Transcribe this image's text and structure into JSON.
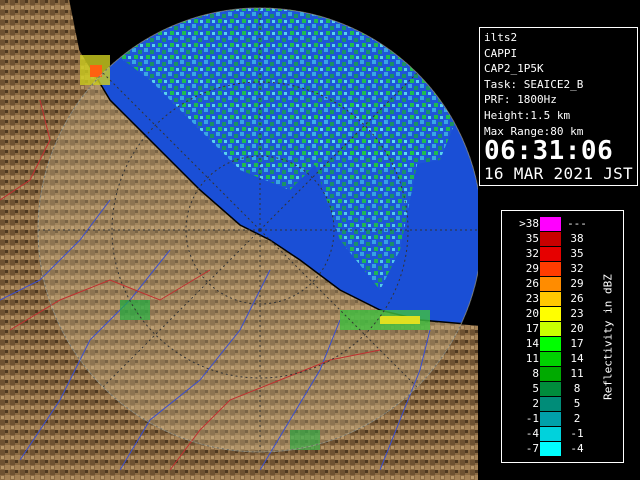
{
  "info": {
    "radar": "ilts2",
    "product": "CAPPI",
    "product_code": "CAP2_1P5K",
    "task": "Task: SEAICE2_B",
    "prf": "PRF: 1800Hz",
    "height": "Height:1.5 km",
    "max_range": "Max Range:80 km",
    "time": "06:31:06",
    "date": "16 MAR 2021 JST"
  },
  "legend": {
    "unit": "Reflectivity in dBZ",
    "rows": [
      {
        "lo": ">38",
        "hi": "---",
        "color": "#ff00ff"
      },
      {
        "lo": "35",
        "hi": "38",
        "color": "#c80000"
      },
      {
        "lo": "32",
        "hi": "35",
        "color": "#e60000"
      },
      {
        "lo": "29",
        "hi": "32",
        "color": "#ff3c00"
      },
      {
        "lo": "26",
        "hi": "29",
        "color": "#ff8c00"
      },
      {
        "lo": "23",
        "hi": "26",
        "color": "#ffc800"
      },
      {
        "lo": "20",
        "hi": "23",
        "color": "#ffff00"
      },
      {
        "lo": "17",
        "hi": "20",
        "color": "#c8ff00"
      },
      {
        "lo": "14",
        "hi": "17",
        "color": "#00ff00"
      },
      {
        "lo": "11",
        "hi": "14",
        "color": "#00d200"
      },
      {
        "lo": "8",
        "hi": "11",
        "color": "#00aa00"
      },
      {
        "lo": "5",
        "hi": "8",
        "color": "#008c3c"
      },
      {
        "lo": "2",
        "hi": "5",
        "color": "#008c78"
      },
      {
        "lo": "-1",
        "hi": "2",
        "color": "#00a0aa"
      },
      {
        "lo": "-4",
        "hi": "-1",
        "color": "#00d2dc"
      },
      {
        "lo": "-7",
        "hi": "-4",
        "color": "#00ffff"
      }
    ]
  }
}
